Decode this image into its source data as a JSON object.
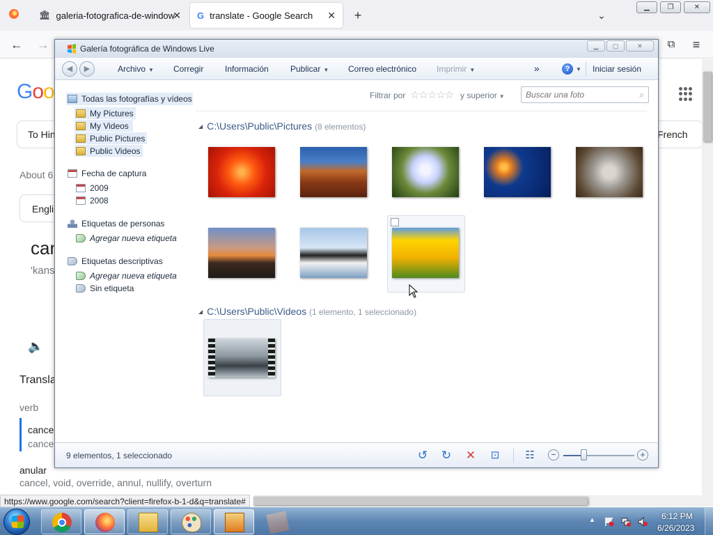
{
  "browser": {
    "tabs": [
      {
        "label": "galeria-fotografica-de-windows",
        "active": false
      },
      {
        "label": "translate - Google Search",
        "active": true
      }
    ],
    "status_url": "https://www.google.com/search?client=firefox-b-1-d&q=translate#"
  },
  "google_bg": {
    "logo": "Goo",
    "from_lang": "To Hin",
    "to_lang": "French",
    "about": "About 6",
    "english": "Engli",
    "word": "can",
    "phonetic": "'kans",
    "translations_label": "Transla",
    "pos": "verb",
    "result_primary": "cance",
    "result_secondary": "cance",
    "alt_word": "anular",
    "alt_synonyms": "cancel, void, override, annul, nullify, overturn"
  },
  "gallery": {
    "title": "Galería fotográfica de Windows Live",
    "menu": {
      "archivo": "Archivo",
      "corregir": "Corregir",
      "informacion": "Información",
      "publicar": "Publicar",
      "correo": "Correo electrónico",
      "imprimir": "Imprimir",
      "more": "»",
      "help": "?",
      "signin": "Iniciar sesión"
    },
    "nav": {
      "all": "Todas las fotografías y vídeos",
      "my_pictures": "My Pictures",
      "my_videos": "My Videos",
      "public_pictures": "Public Pictures",
      "public_videos": "Public Videos",
      "date_taken": "Fecha de captura",
      "year_2009": "2009",
      "year_2008": "2008",
      "people_tags": "Etiquetas de personas",
      "add_people_tag": "Agregar nueva etiqueta",
      "desc_tags": "Etiquetas descriptivas",
      "add_desc_tag": "Agregar nueva etiqueta",
      "untagged": "Sin etiqueta"
    },
    "filter": {
      "label": "Filtrar por",
      "stars": "☆☆☆☆☆",
      "rating": "y superior",
      "search_placeholder": "Buscar una foto"
    },
    "groups": {
      "pictures_path": "C:\\Users\\Public\\Pictures",
      "pictures_count": "(8 elementos)",
      "videos_path": "C:\\Users\\Public\\Videos",
      "videos_count": "(1 elemento, 1 seleccionado)"
    },
    "status": "9 elementos, 1 seleccionado",
    "zoom_level": 0.28
  },
  "taskbar": {
    "time": "6:12 PM",
    "date": "6/26/2023"
  }
}
